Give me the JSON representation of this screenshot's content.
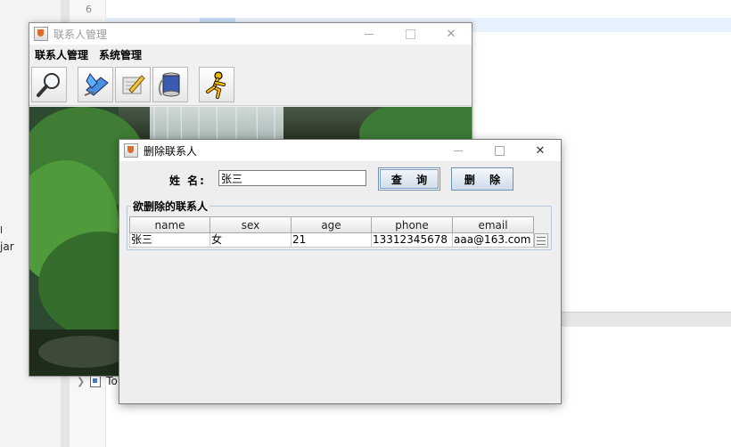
{
  "ide": {
    "line_number": "6",
    "semicolon": ";",
    "left_snippet_1": "l",
    "left_snippet_2": "jar",
    "tree_item": "To"
  },
  "main_window": {
    "title": "联系人管理",
    "menu": [
      "联系人管理",
      "系统管理"
    ],
    "toolbar_icons": [
      "magnifier-icon",
      "pen-icon",
      "edit-pencil-icon",
      "thread-spool-icon",
      "running-man-icon"
    ]
  },
  "dialog": {
    "title": "删除联系人",
    "name_label": "姓 名:",
    "name_value": "张三",
    "query_button": "查 询",
    "delete_button": "删 除",
    "group_title": "欲删除的联系人",
    "table": {
      "headers": [
        "name",
        "sex",
        "age",
        "phone",
        "email"
      ],
      "rows": [
        [
          "张三",
          "女",
          "21",
          "13312345678",
          "aaa@163.com"
        ]
      ]
    }
  },
  "window_controls": {
    "minimize": "—",
    "close": "✕"
  }
}
